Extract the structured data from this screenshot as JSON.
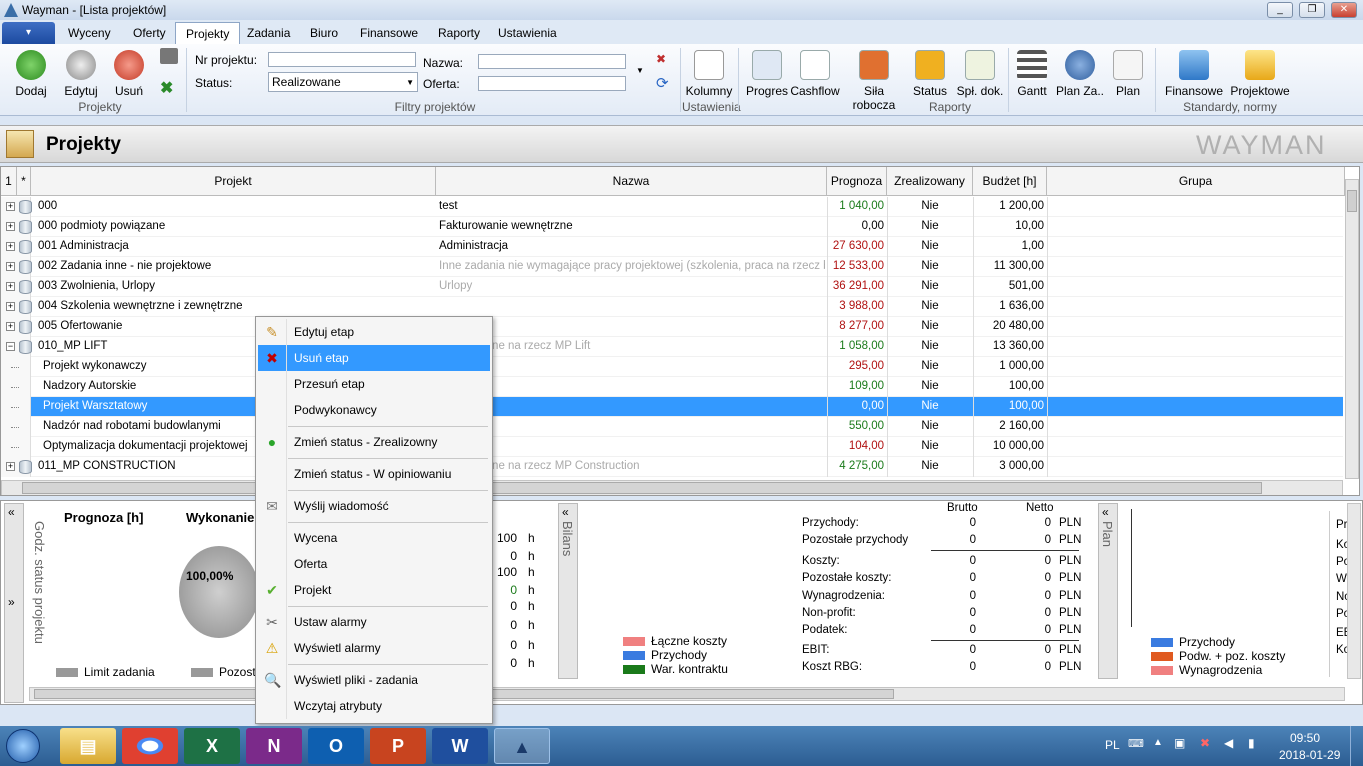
{
  "window": {
    "title": "Wayman - [Lista projektów]"
  },
  "menu": [
    "Wyceny",
    "Oferty",
    "Projekty",
    "Zadania",
    "Biuro",
    "Finansowe",
    "Raporty",
    "Ustawienia"
  ],
  "ribbon": {
    "projekty": {
      "dodaj": "Dodaj",
      "edytuj": "Edytuj",
      "usun": "Usuń",
      "group": "Projekty"
    },
    "filters": {
      "nr_label": "Nr projektu:",
      "status_label": "Status:",
      "status_value": "Realizowane",
      "nazwa_label": "Nazwa:",
      "oferta_label": "Oferta:",
      "group": "Filtry projektów"
    },
    "kolumny": "Kolumny",
    "ustawienia_group": "Ustawienia",
    "raporty": [
      "Progres",
      "Cashflow",
      "Siła robocza",
      "Status",
      "Spł. dok."
    ],
    "raporty_group": "Raporty",
    "gantt": "Gantt",
    "planza": "Plan Za..",
    "plan": "Plan",
    "finansowe": "Finansowe",
    "projektowe": "Projektowe",
    "standardy_group": "Standardy, normy"
  },
  "header": {
    "title": "Projekty",
    "logo": "WAYMAN"
  },
  "grid": {
    "corner": "1",
    "star": "*",
    "columns": [
      "Projekt",
      "Nazwa",
      "Prognoza",
      "Zrealizowany",
      "Budżet [h]",
      "Grupa"
    ],
    "rows": [
      {
        "projekt": "000",
        "nazwa": "test",
        "prognoza": "1 040,00",
        "pcolor": "green",
        "zreal": "Nie",
        "budzet": "1 200,00"
      },
      {
        "projekt": "000 podmioty powiązane",
        "nazwa": "Fakturowanie wewnętrzne",
        "prognoza": "0,00",
        "pcolor": "black",
        "zreal": "Nie",
        "budzet": "10,00"
      },
      {
        "projekt": "001 Administracja",
        "nazwa": "Administracja",
        "prognoza": "27 630,00",
        "pcolor": "red",
        "zreal": "Nie",
        "budzet": "1,00"
      },
      {
        "projekt": "002 Zadania inne - nie projektowe",
        "nazwa": "Inne zadania nie wymagające pracy projektowej (szkolenia, praca na rzecz bi",
        "prognoza": "12 533,00",
        "pcolor": "red",
        "zreal": "Nie",
        "budzet": "11 300,00"
      },
      {
        "projekt": "003 Zwolnienia, Urlopy",
        "nazwa": "Urlopy",
        "prognoza": "36 291,00",
        "pcolor": "red",
        "zreal": "Nie",
        "budzet": "501,00"
      },
      {
        "projekt": "004 Szkolenia wewnętrzne i zewnętrzne",
        "nazwa": "",
        "prognoza": "3 988,00",
        "pcolor": "red",
        "zreal": "Nie",
        "budzet": "1 636,00"
      },
      {
        "projekt": "005 Ofertowanie",
        "nazwa": "",
        "prognoza": "8 277,00",
        "pcolor": "red",
        "zreal": "Nie",
        "budzet": "20 480,00"
      },
      {
        "projekt": "010_MP LIFT",
        "nazwa": "wykonywane na rzecz MP Lift",
        "prognoza": "1 058,00",
        "pcolor": "green",
        "zreal": "Nie",
        "budzet": "13 360,00"
      },
      {
        "projekt": "Projekt wykonawczy",
        "nazwa": "",
        "prognoza": "295,00",
        "pcolor": "red",
        "zreal": "Nie",
        "budzet": "1 000,00"
      },
      {
        "projekt": "Nadzory Autorskie",
        "nazwa": "",
        "prognoza": "109,00",
        "pcolor": "green",
        "zreal": "Nie",
        "budzet": "100,00"
      },
      {
        "projekt": "Projekt Warsztatowy",
        "nazwa": "",
        "prognoza": "0,00",
        "pcolor": "black",
        "zreal": "Nie",
        "budzet": "100,00"
      },
      {
        "projekt": "Nadzór nad robotami budowlanymi",
        "nazwa": "",
        "prognoza": "550,00",
        "pcolor": "green",
        "zreal": "Nie",
        "budzet": "2 160,00"
      },
      {
        "projekt": "Optymalizacja dokumentacji projektowej",
        "nazwa": "",
        "prognoza": "104,00",
        "pcolor": "red",
        "zreal": "Nie",
        "budzet": "10 000,00"
      },
      {
        "projekt": "011_MP CONSTRUCTION",
        "nazwa": "wykonywane na rzecz MP Construction",
        "prognoza": "4 275,00",
        "pcolor": "green",
        "zreal": "Nie",
        "budzet": "3 000,00"
      }
    ]
  },
  "bottom": {
    "side1": "Godz. status projektu",
    "prognoza": "Prognoza [h]",
    "wykonanie": "Wykonanie",
    "pie_label": "100,00%",
    "legend1": "Limit zadania",
    "legend2": "Pozosta",
    "hours": [
      {
        "v": "100",
        "u": "h"
      },
      {
        "v": "0",
        "u": "h"
      },
      {
        "v": "100",
        "u": "h"
      },
      {
        "v": "0",
        "u": "h"
      },
      {
        "v": "0",
        "u": "h"
      },
      {
        "v": "0",
        "u": "h"
      },
      {
        "v": "0",
        "u": "h"
      },
      {
        "v": "0",
        "u": "h"
      }
    ],
    "bilans": "Bilans",
    "bilans_legend": [
      {
        "label": "Łączne koszty",
        "color": "#f08080"
      },
      {
        "label": "Przychody",
        "color": "#3a7be0"
      },
      {
        "label": "War. kontraktu",
        "color": "#1a7a1a"
      }
    ],
    "brutto": "Brutto",
    "netto": "Netto",
    "fin_rows": [
      {
        "label": "Przychody:",
        "b": "0",
        "n": "0",
        "c": "PLN"
      },
      {
        "label": "Pozostałe przychody",
        "b": "0",
        "n": "0",
        "c": "PLN"
      },
      {
        "label": "Koszty:",
        "b": "0",
        "n": "0",
        "c": "PLN"
      },
      {
        "label": "Pozostałe koszty:",
        "b": "0",
        "n": "0",
        "c": "PLN"
      },
      {
        "label": "Wynagrodzenia:",
        "b": "0",
        "n": "0",
        "c": "PLN"
      },
      {
        "label": "Non-profit:",
        "b": "0",
        "n": "0",
        "c": "PLN"
      },
      {
        "label": "Podatek:",
        "b": "0",
        "n": "0",
        "c": "PLN"
      },
      {
        "label": "EBIT:",
        "b": "0",
        "n": "0",
        "c": "PLN"
      },
      {
        "label": "Koszt RBG:",
        "b": "0",
        "n": "0",
        "c": "PLN"
      }
    ],
    "plan": "Plan",
    "plan_legend": [
      {
        "label": "Przychody",
        "color": "#3a7be0"
      },
      {
        "label": "Podw. + poz. koszty",
        "color": "#e05a20"
      },
      {
        "label": "Wynagrodzenia",
        "color": "#f08080"
      }
    ],
    "right_cut": [
      "Przy",
      "Kosz",
      "Pozo",
      "Wyn",
      "Non",
      "Poda",
      "EBIT",
      "Kosz"
    ]
  },
  "context_menu": {
    "items": [
      {
        "label": "Edytuj etap",
        "icon": "pencil-icon",
        "glyph": "✎",
        "color": "#c8902a"
      },
      {
        "label": "Usuń etap",
        "icon": "delete-x-icon",
        "glyph": "✖",
        "color": "#c00000"
      },
      {
        "label": "Przesuń etap",
        "icon": "",
        "glyph": "",
        "color": ""
      },
      {
        "label": "Podwykonawcy",
        "icon": "",
        "glyph": "",
        "color": ""
      },
      {
        "label": "Zmień status - Zrealizowny",
        "icon": "green-dot-icon",
        "glyph": "●",
        "color": "#2aa52a"
      },
      {
        "label": "Zmień status - W opiniowaniu",
        "icon": "",
        "glyph": "",
        "color": ""
      },
      {
        "label": "Wyślij wiadomość",
        "icon": "envelope-icon",
        "glyph": "✉",
        "color": "#777"
      },
      {
        "label": "Wycena",
        "icon": "",
        "glyph": "",
        "color": ""
      },
      {
        "label": "Oferta",
        "icon": "",
        "glyph": "",
        "color": ""
      },
      {
        "label": "Projekt",
        "icon": "check-icon",
        "glyph": "✔",
        "color": "#58b030"
      },
      {
        "label": "Ustaw alarmy",
        "icon": "tools-icon",
        "glyph": "✂",
        "color": "#666"
      },
      {
        "label": "Wyświetl alarmy",
        "icon": "warning-icon",
        "glyph": "⚠",
        "color": "#d8a000"
      },
      {
        "label": "Wyświetl pliki - zadania",
        "icon": "magnifier-icon",
        "glyph": "🔍",
        "color": "#666"
      },
      {
        "label": "Wczytaj atrybuty",
        "icon": "",
        "glyph": "",
        "color": ""
      }
    ]
  },
  "taskbar": {
    "lang": "PL",
    "time": "09:50",
    "date": "2018-01-29"
  }
}
